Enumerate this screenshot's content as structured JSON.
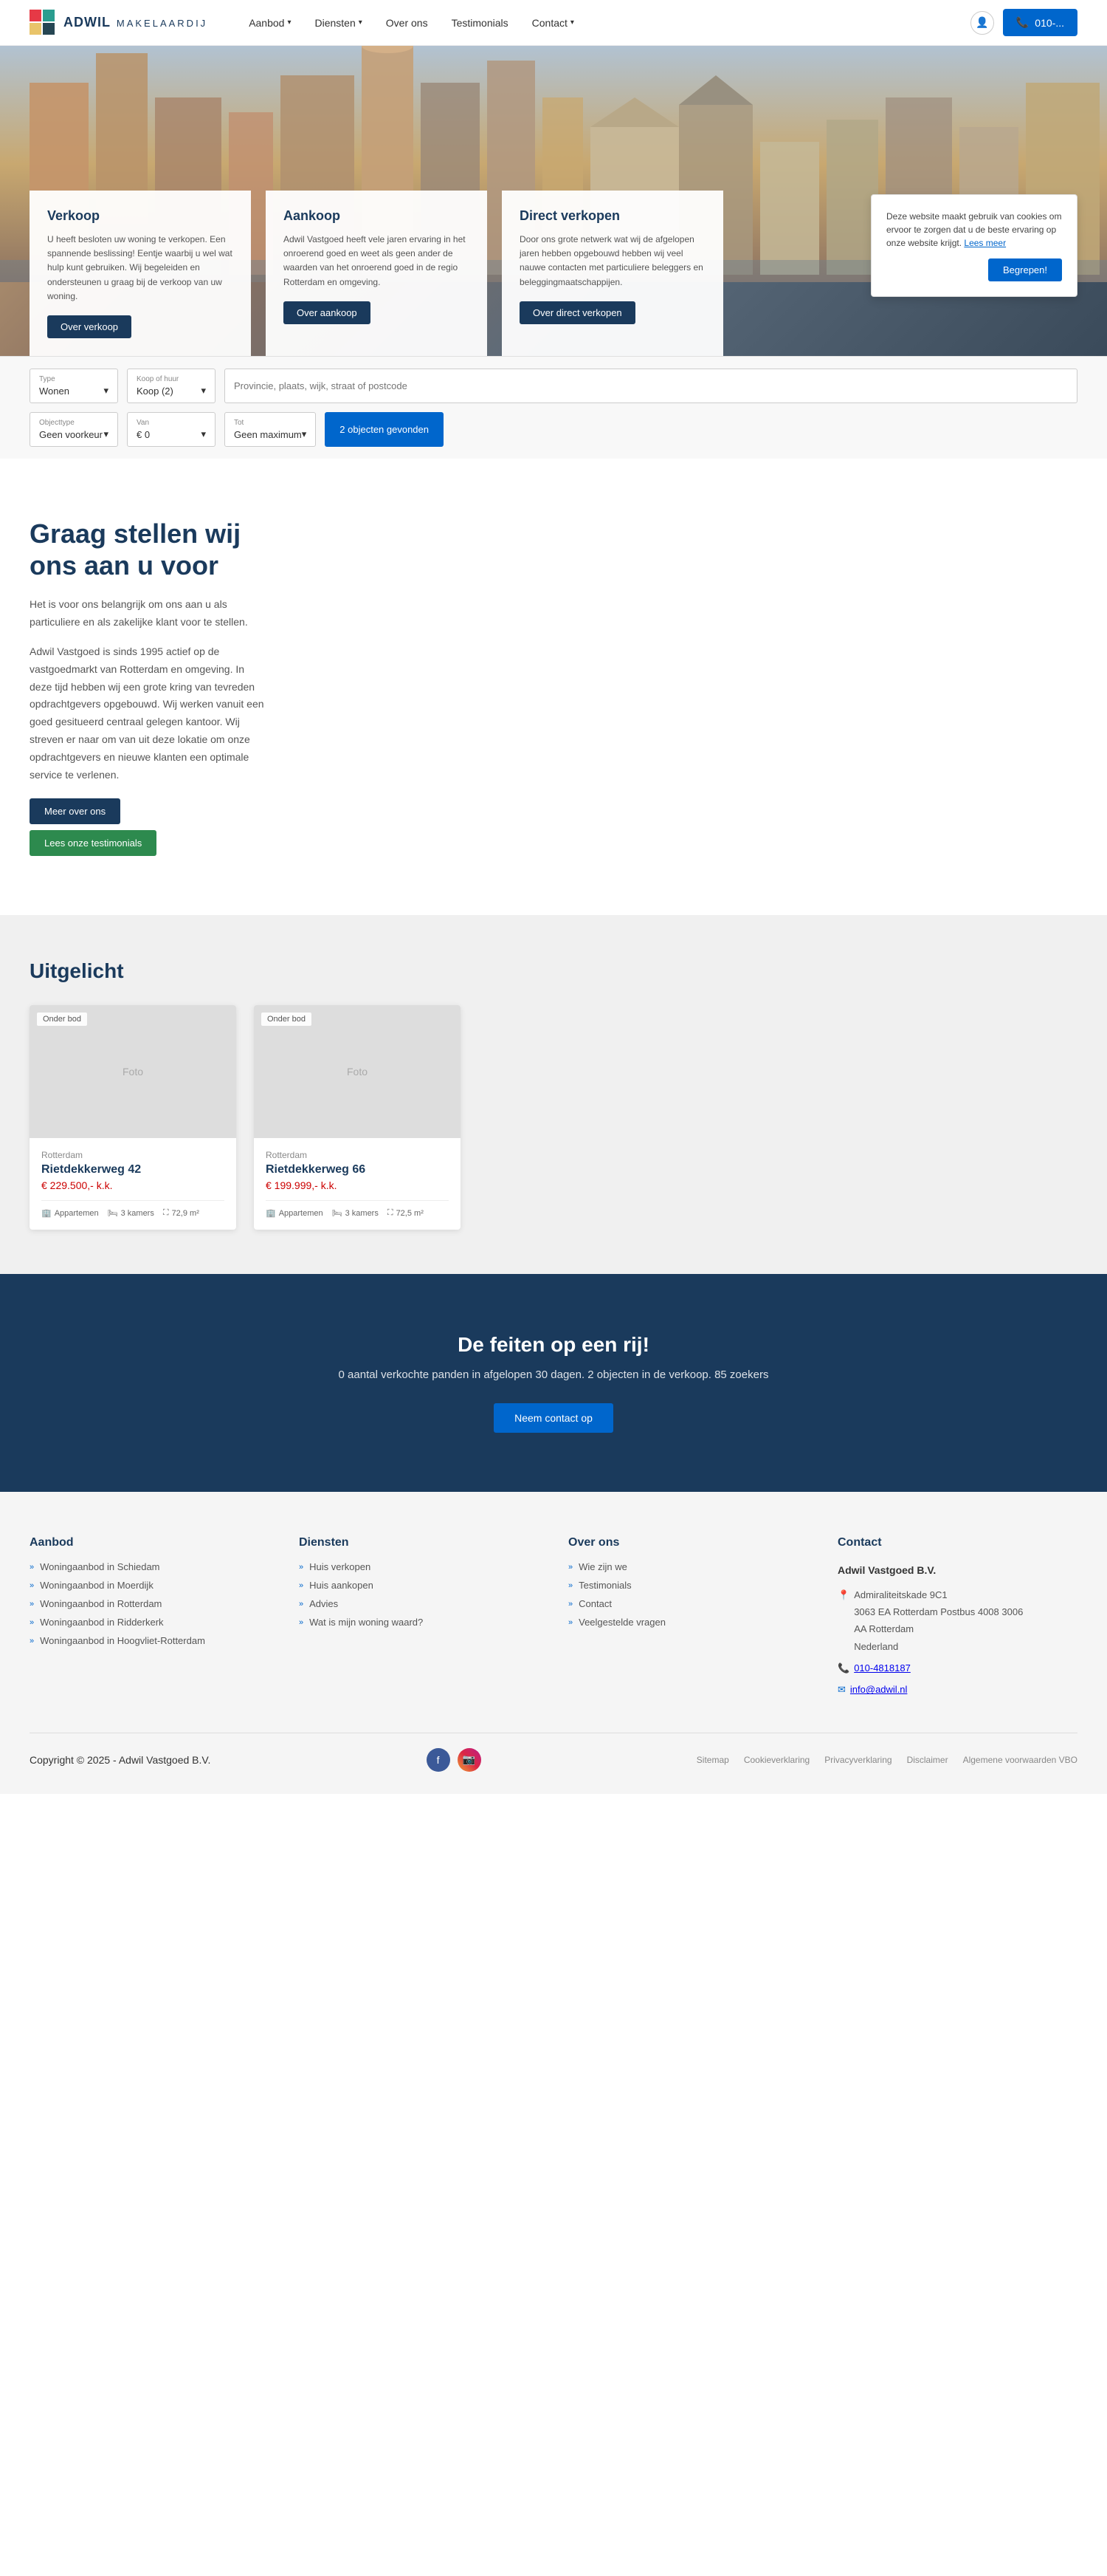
{
  "header": {
    "logo_brand": "ADWIL",
    "logo_sub": "MAKELAARDIJ",
    "nav_items": [
      {
        "label": "Aanbod",
        "has_dropdown": true
      },
      {
        "label": "Diensten",
        "has_dropdown": true
      },
      {
        "label": "Over ons",
        "has_dropdown": false
      },
      {
        "label": "Testimonials",
        "has_dropdown": false
      },
      {
        "label": "Contact",
        "has_dropdown": true
      }
    ],
    "phone_number": "010-..."
  },
  "hero": {
    "cards": [
      {
        "title": "Verkoop",
        "description": "U heeft besloten uw woning te verkopen. Een spannende beslissing! Eentje waarbij u wel wat hulp kunt gebruiken. Wij begeleiden en ondersteunen u graag bij de verkoop van uw woning.",
        "button_label": "Over verkoop"
      },
      {
        "title": "Aankoop",
        "description": "Adwil Vastgoed heeft vele jaren ervaring in het onroerend goed en weet als geen ander de waarden van het onroerend goed in de regio Rotterdam en omgeving.",
        "button_label": "Over aankoop"
      },
      {
        "title": "Direct verkopen",
        "description": "Door ons grote netwerk wat wij de afgelopen jaren hebben opgebouwd hebben wij veel nauwe contacten met particuliere beleggers en beleggingmaatschappijen.",
        "button_label": "Over direct verkopen"
      }
    ]
  },
  "cookie_banner": {
    "text": "Deze website maakt gebruik van cookies om ervoor te zorgen dat u de beste ervaring op onze website krijgt.",
    "link_text": "Lees meer",
    "button_label": "Begrepen!"
  },
  "search": {
    "row1": {
      "type_label": "Type",
      "type_value": "Wonen",
      "koop_label": "Koop of huur",
      "koop_value": "Koop (2)",
      "location_placeholder": "Provincie, plaats, wijk, straat of postcode"
    },
    "row2": {
      "object_label": "Objecttype",
      "object_value": "Geen voorkeur",
      "van_label": "Van",
      "van_value": "€ 0",
      "tot_label": "Tot",
      "tot_value": "Geen maximum",
      "button_label": "2 objecten gevonden"
    }
  },
  "intro": {
    "title": "Graag stellen wij ons aan u voor",
    "paragraph1": "Het is voor ons belangrijk om ons aan u als particuliere en als zakelijke klant voor te stellen.",
    "paragraph2": "Adwil Vastgoed is sinds 1995 actief op de vastgoedmarkt van Rotterdam en omgeving. In deze tijd hebben wij een grote kring van tevreden opdrachtgevers opgebouwd. Wij werken vanuit een goed gesitueerd centraal gelegen kantoor. Wij streven er naar om van uit deze lokatie om onze opdrachtgevers en nieuwe klanten een optimale service te verlenen.",
    "btn1_label": "Meer over ons",
    "btn2_label": "Lees onze testimonials"
  },
  "uitgelicht": {
    "title": "Uitgelicht",
    "properties": [
      {
        "badge": "Onder bod",
        "city": "Rotterdam",
        "name": "Rietdekkerweg 42",
        "price": "€ 229.500,- k.k.",
        "type": "Appartemen",
        "rooms": "3 kamers",
        "size": "72,9 m²"
      },
      {
        "badge": "Onder bod",
        "city": "Rotterdam",
        "name": "Rietdekkerweg 66",
        "price": "€ 199.999,- k.k.",
        "type": "Appartemen",
        "rooms": "3 kamers",
        "size": "72,5 m²"
      }
    ]
  },
  "feiten": {
    "title": "De feiten op een rij!",
    "description": "0 aantal verkochte panden in afgelopen 30 dagen. 2 objecten in de verkoop. 85 zoekers",
    "button_label": "Neem contact op"
  },
  "footer": {
    "aanbod_title": "Aanbod",
    "aanbod_items": [
      "Woningaanbod in Schiedam",
      "Woningaanbod in Moerdijk",
      "Woningaanbod in Rotterdam",
      "Woningaanbod in Ridderkerk",
      "Woningaanbod in Hoogvliet-Rotterdam"
    ],
    "diensten_title": "Diensten",
    "diensten_items": [
      "Huis verkopen",
      "Huis aankopen",
      "Advies",
      "Wat is mijn woning waard?"
    ],
    "overons_title": "Over ons",
    "overons_items": [
      "Wie zijn we",
      "Testimonials",
      "Contact",
      "Veelgestelde vragen"
    ],
    "contact_title": "Contact",
    "contact_company": "Adwil Vastgoed B.V.",
    "contact_address": "Admiraliteitskade 9C1\n3063 EA Rotterdam Postbus 4008 3006\nAA Rotterdam\nNederland",
    "contact_phone": "010-4818187",
    "contact_email": "info@adwil.nl",
    "copyright": "Copyright © 2025 - Adwil Vastgoed B.V.",
    "bottom_links": [
      "Sitemap",
      "Cookieverklaring",
      "Privacyverklaring",
      "Disclaimer",
      "Algemene voorwaarden VBO"
    ]
  }
}
